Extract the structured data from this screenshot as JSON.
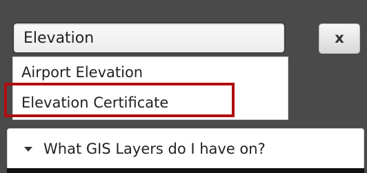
{
  "search": {
    "value": "Elevation"
  },
  "clear_button": {
    "label": "x"
  },
  "suggestions": [
    {
      "label": "Airport Elevation"
    },
    {
      "label": "Elevation Certificate"
    }
  ],
  "accordion": {
    "label": "What GIS Layers do I have on?"
  },
  "colors": {
    "panel_background": "#4a4a4a",
    "highlight_border": "#b20d10",
    "text": "#222222"
  }
}
